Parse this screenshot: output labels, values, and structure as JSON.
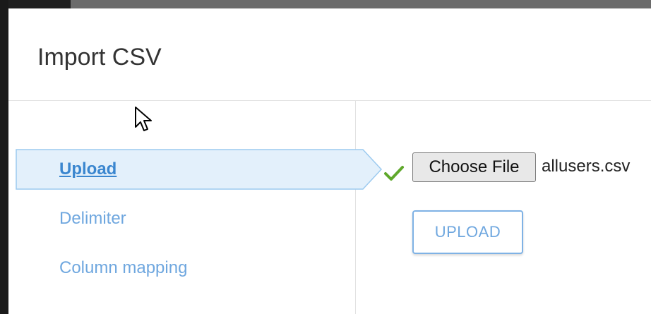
{
  "dialog": {
    "title": "Import CSV"
  },
  "steps": [
    {
      "label": "Upload",
      "active": true
    },
    {
      "label": "Delimiter",
      "active": false
    },
    {
      "label": "Column mapping",
      "active": false
    }
  ],
  "upload_panel": {
    "choose_file_label": "Choose File",
    "selected_file": "allusers.csv",
    "upload_button_label": "UPLOAD",
    "status_icon": "check-icon"
  },
  "colors": {
    "accent": "#3a86cf",
    "link": "#6fa7df",
    "active_step_bg": "#e3f0fb",
    "check": "#5fa82b"
  }
}
